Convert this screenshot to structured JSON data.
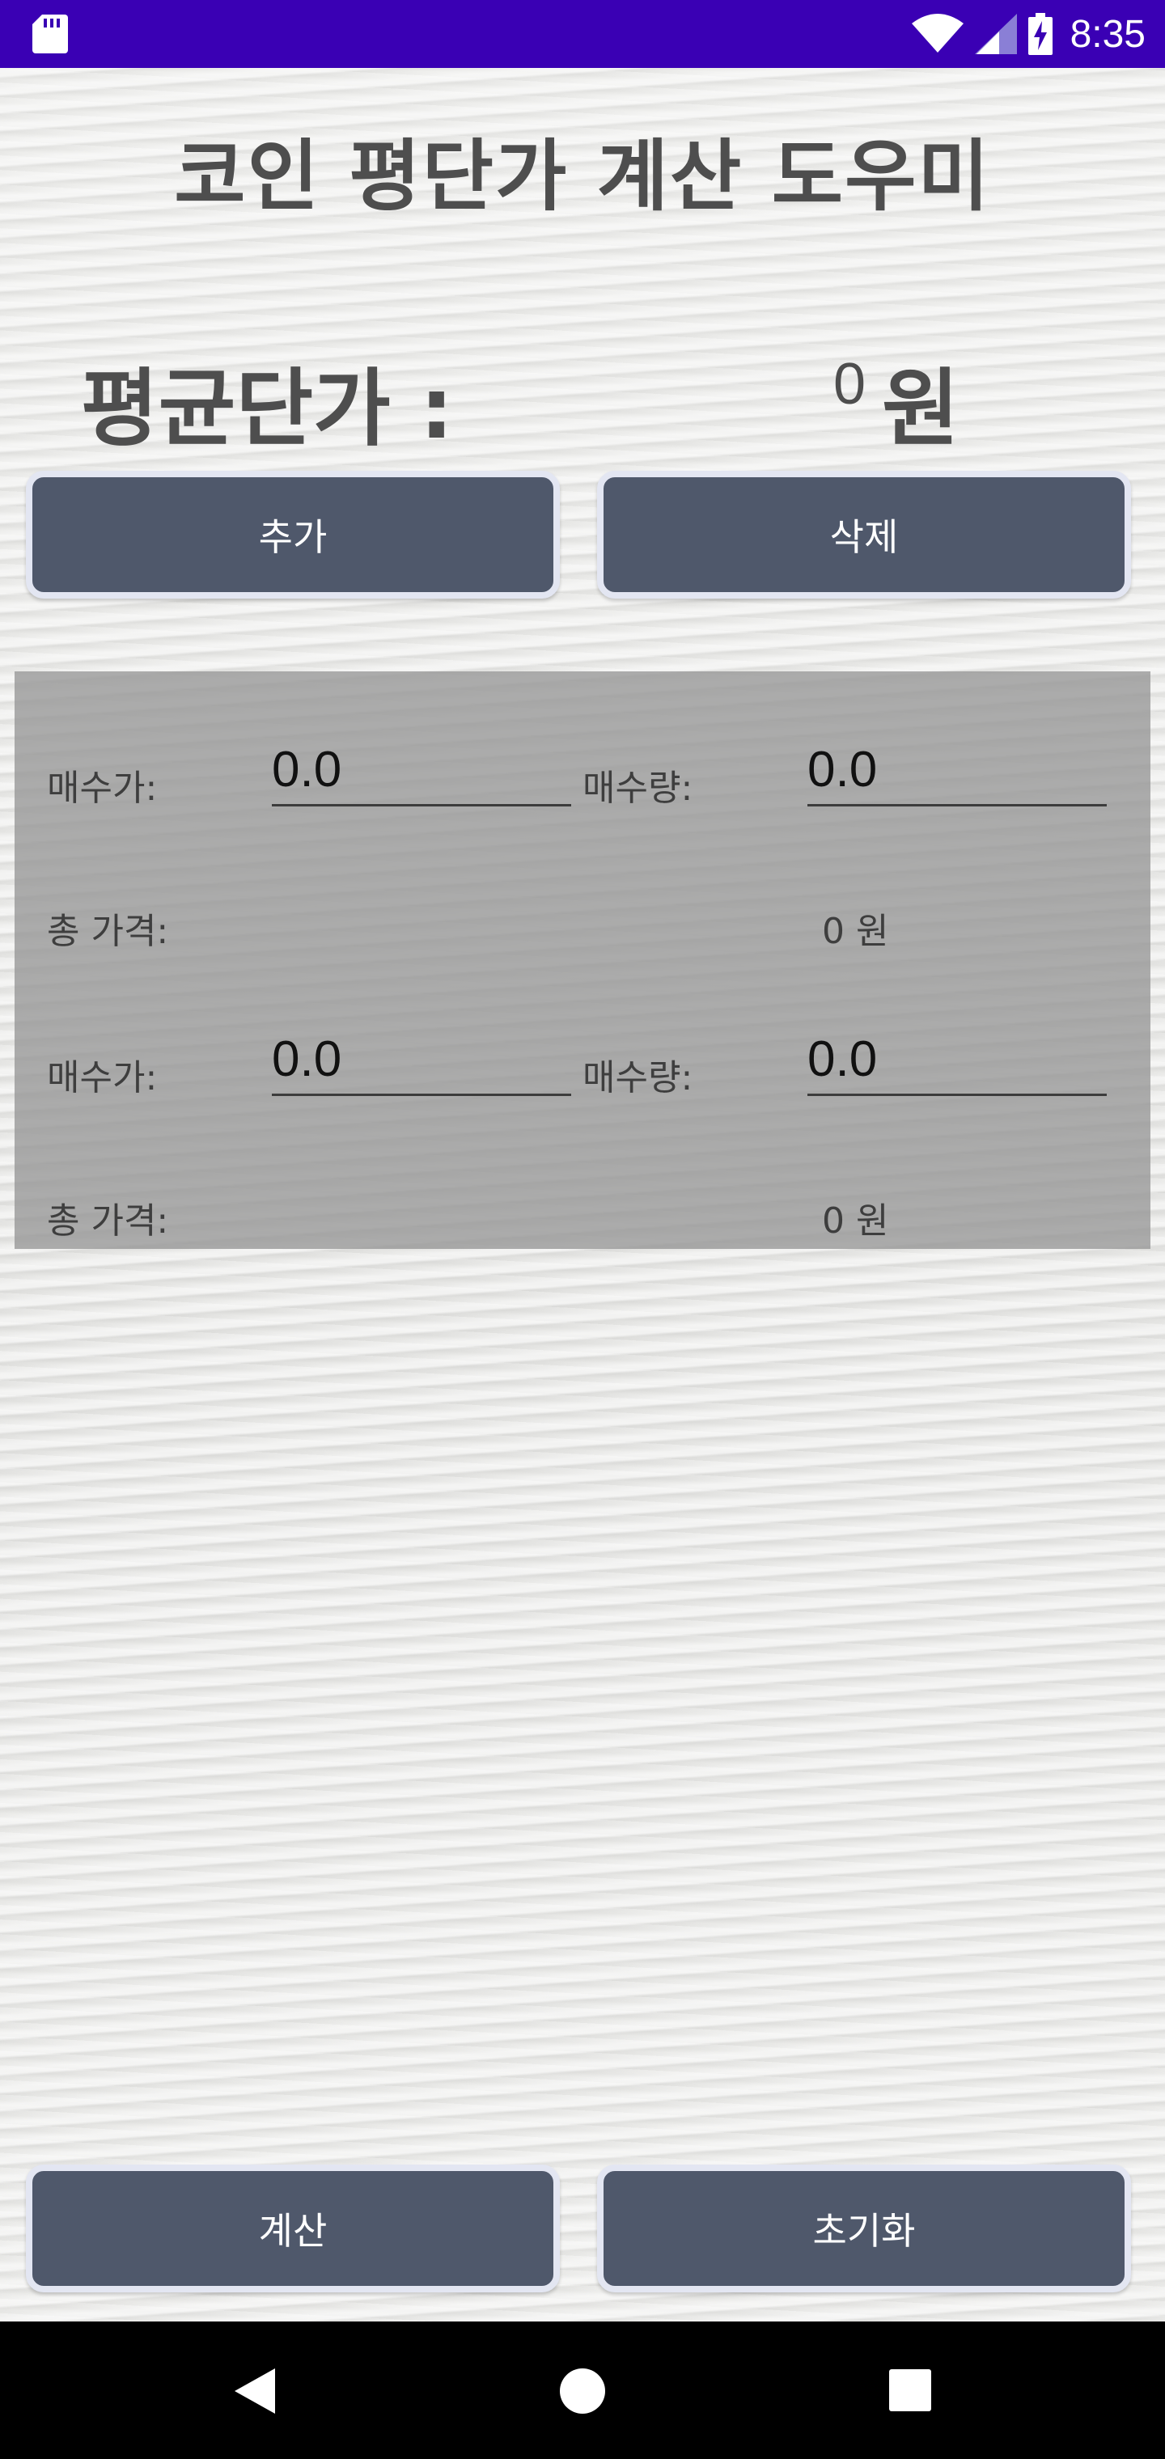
{
  "status_bar": {
    "time": "8:35",
    "icons": [
      "sd-card-icon",
      "wifi-icon",
      "signal-icon",
      "battery-charging-icon"
    ],
    "background_color": "#3a00b4"
  },
  "title": "코인 평단가 계산 도우미",
  "average": {
    "label": "평균단가 :",
    "value": "0",
    "unit": "원"
  },
  "top_buttons": {
    "add_label": "추가",
    "delete_label": "삭제"
  },
  "entries": [
    {
      "price_label": "매수가:",
      "price_value": "0.0",
      "qty_label": "매수량:",
      "qty_value": "0.0",
      "total_label": "총 가격:",
      "total_value": "0 원"
    },
    {
      "price_label": "매수가:",
      "price_value": "0.0",
      "qty_label": "매수량:",
      "qty_value": "0.0",
      "total_label": "총 가격:",
      "total_value": "0 원"
    }
  ],
  "bottom_buttons": {
    "calculate_label": "계산",
    "reset_label": "초기화"
  },
  "colors": {
    "button_fill": "#4f586b",
    "button_border": "#e3e6f2",
    "panel": "#969696",
    "title_text": "#4e4e4e"
  },
  "nav_bar": {
    "icons": [
      "back-icon",
      "home-icon",
      "recents-icon"
    ]
  }
}
